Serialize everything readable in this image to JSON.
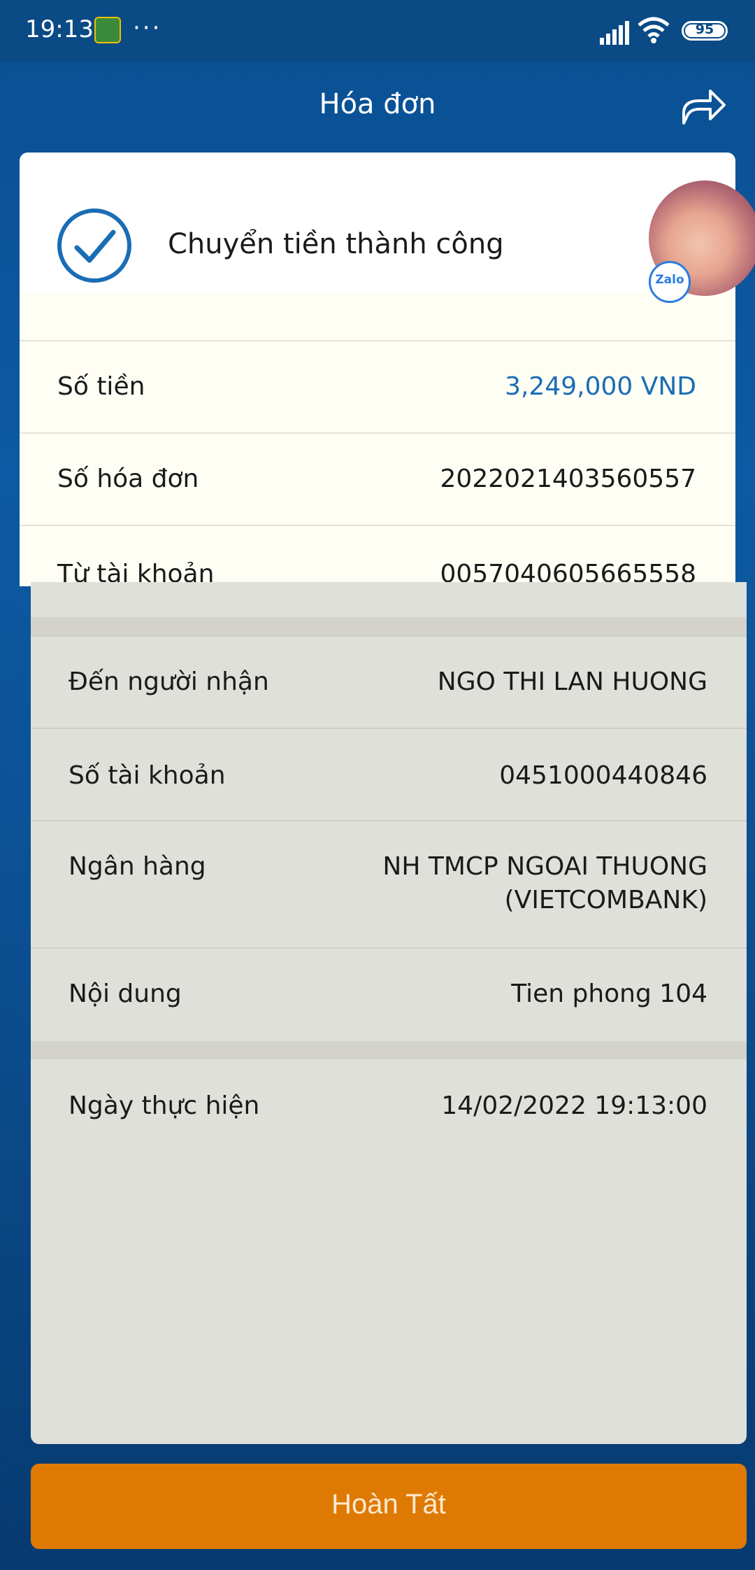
{
  "status_bar": {
    "time": "19:13",
    "dots": "···",
    "battery": "95"
  },
  "header": {
    "title": "Hóa đơn",
    "share_icon": "share-forward-icon"
  },
  "success": {
    "text": "Chuyển tiền thành công",
    "icon": "check-circle-icon"
  },
  "avatar": {
    "badge": "Zalo"
  },
  "details": {
    "amount": {
      "label": "Số tiền",
      "value": "3,249,000 VND"
    },
    "invoice": {
      "label": "Số hóa đơn",
      "value": "2022021403560557"
    },
    "from_account": {
      "label": "Từ tài khoản",
      "value": "0057040605665558"
    },
    "recipient": {
      "label": "Đến người nhận",
      "value": "NGO THI LAN HUONG"
    },
    "account_no": {
      "label": "Số tài khoản",
      "value": "0451000440846"
    },
    "bank": {
      "label": "Ngân hàng",
      "value_line1": "NH TMCP NGOAI THUONG",
      "value_line2": "(VIETCOMBANK)"
    },
    "content": {
      "label": "Nội dung",
      "value": "Tien phong 104"
    },
    "date": {
      "label": "Ngày thực hiện",
      "value": "14/02/2022 19:13:00"
    }
  },
  "actions": {
    "done": "Hoàn Tất"
  },
  "colors": {
    "accent_blue": "#1a6db5",
    "button_orange": "#de7a04",
    "background_blue": "#0a4f92"
  }
}
